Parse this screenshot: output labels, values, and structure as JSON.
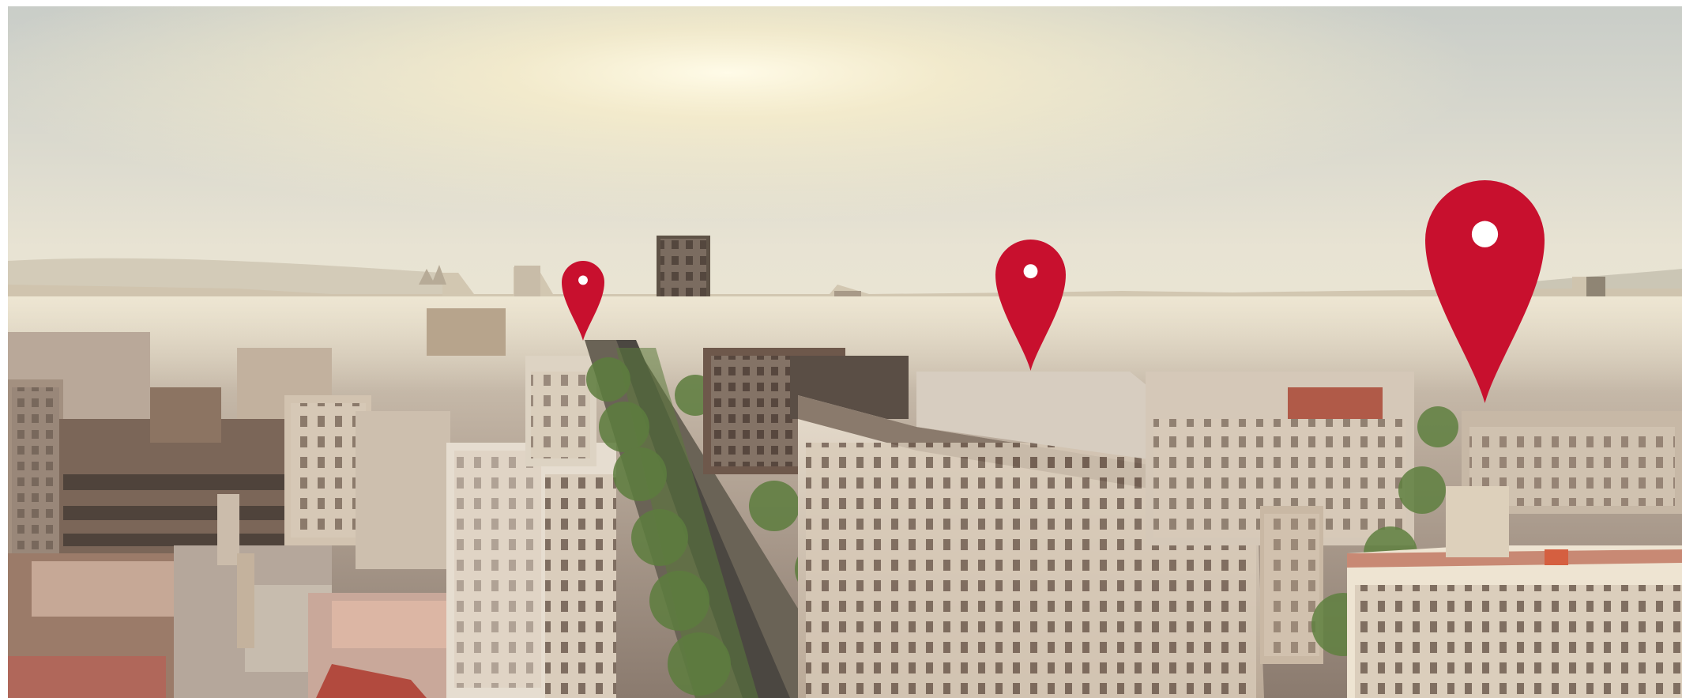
{
  "scene": {
    "kind": "city-panorama-photo",
    "palette": {
      "sky_top": "#cfd3cf",
      "sky_glow": "#fff6d6",
      "haze": "#efe6cf",
      "buildings_light": "#d8cbb8",
      "buildings_mid": "#a89686",
      "buildings_dark": "#6c5e55",
      "trees": "#6f8c4a",
      "road": "#4a4a4a"
    }
  },
  "markers": [
    {
      "id": "marker-1",
      "icon": "map-pin-icon",
      "color": "#c8102e",
      "hole_color": "#ffffff"
    },
    {
      "id": "marker-2",
      "icon": "map-pin-icon",
      "color": "#c8102e",
      "hole_color": "#ffffff"
    },
    {
      "id": "marker-3",
      "icon": "map-pin-icon",
      "color": "#c8102e",
      "hole_color": "#ffffff"
    }
  ]
}
